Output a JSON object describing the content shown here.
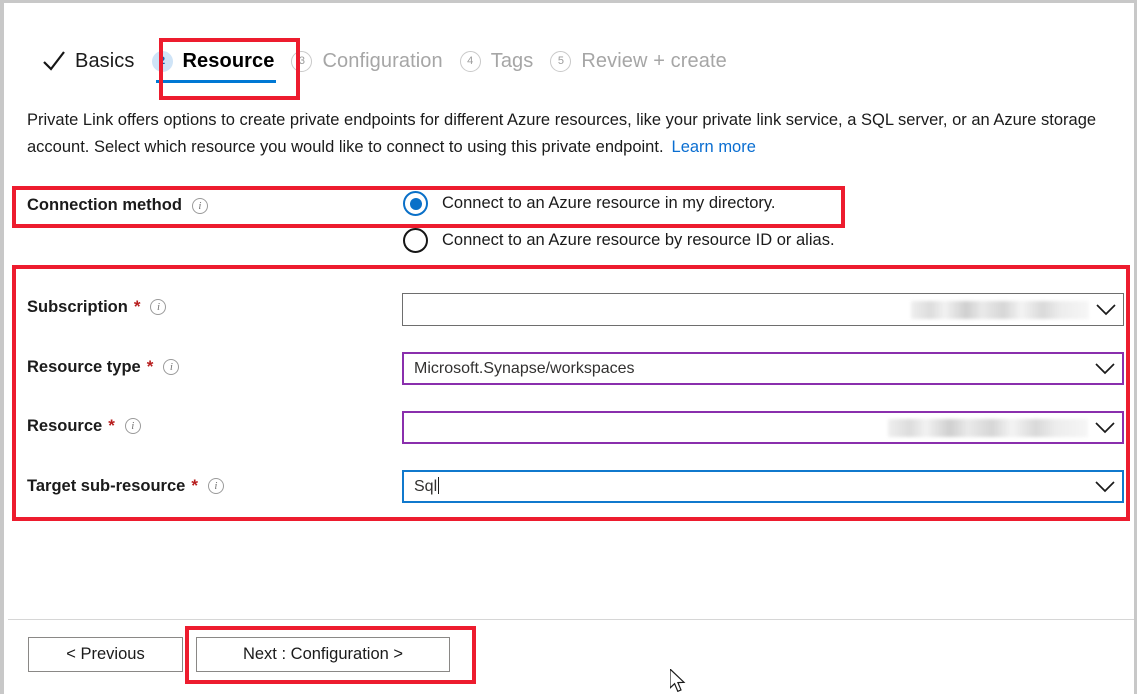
{
  "wizard": {
    "tabs": [
      {
        "label": "Basics",
        "icon": "check-icon",
        "state": "completed",
        "number": null
      },
      {
        "label": "Resource",
        "icon": null,
        "state": "active",
        "number": "2"
      },
      {
        "label": "Configuration",
        "icon": null,
        "state": "upcoming",
        "number": "3"
      },
      {
        "label": "Tags",
        "icon": null,
        "state": "upcoming",
        "number": "4"
      },
      {
        "label": "Review + create",
        "icon": null,
        "state": "upcoming",
        "number": "5"
      }
    ]
  },
  "description": {
    "line1": "Private Link offers options to create private endpoints for different Azure resources, like your private link service, a SQL server,",
    "line2": "or an Azure storage account. Select which resource you would like to connect to using this private endpoint.",
    "learn_more": "Learn more"
  },
  "connection_method": {
    "label": "Connection method",
    "info_icon": "info-icon",
    "options": [
      {
        "label": "Connect to an Azure resource in my directory.",
        "selected": true
      },
      {
        "label": "Connect to an Azure resource by resource ID or alias.",
        "selected": false
      }
    ]
  },
  "fields": [
    {
      "label": "Subscription",
      "required": "*",
      "info_icon": "info-icon",
      "value": "",
      "redacted": true,
      "border": "default",
      "chevron": "chevron-down-icon"
    },
    {
      "label": "Resource type",
      "required": "*",
      "info_icon": "info-icon",
      "value": "Microsoft.Synapse/workspaces",
      "redacted": false,
      "border": "purple",
      "chevron": "chevron-down-icon"
    },
    {
      "label": "Resource",
      "required": "*",
      "info_icon": "info-icon",
      "value": "",
      "redacted": true,
      "border": "purple",
      "chevron": "chevron-down-icon"
    },
    {
      "label": "Target sub-resource",
      "required": "*",
      "info_icon": "info-icon",
      "value": "Sql",
      "redacted": false,
      "border": "blue",
      "chevron": "chevron-down-icon"
    }
  ],
  "footer": {
    "previous_label": "< Previous",
    "next_label": "Next : Configuration >"
  },
  "colors": {
    "highlight": "#ed1c2e",
    "accent_blue": "#0078d4",
    "focus_blue": "#1079cd",
    "modified_purple": "#8a2fad",
    "required_red": "#b71c1c",
    "link_blue": "#0a6ed1"
  }
}
